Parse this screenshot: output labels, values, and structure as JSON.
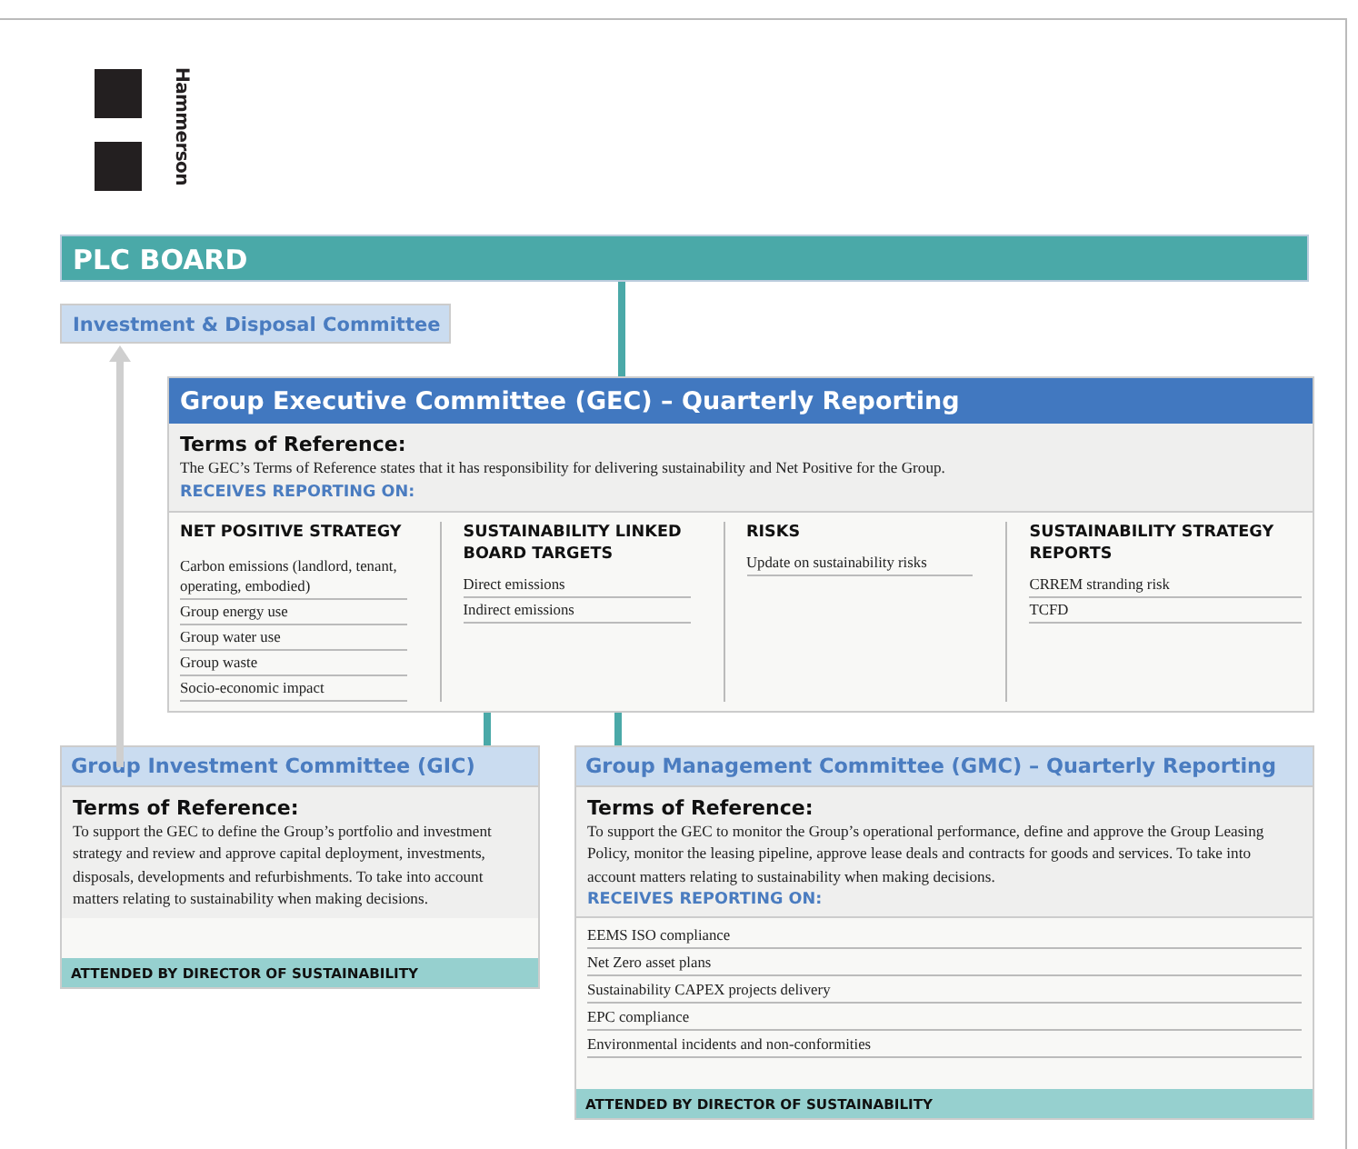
{
  "logo": {
    "name": "Hammerson"
  },
  "board": {
    "title": "PLC BOARD"
  },
  "side_committee": {
    "title": "Investment & Disposal Committee"
  },
  "gec": {
    "title": "Group Executive Committee (GEC) – Quarterly Reporting",
    "terms_heading": "Terms of Reference:",
    "terms": "The GEC’s Terms of Reference states that it has responsibility for delivering sustainability and Net Positive for the Group.",
    "reporting_heading": "RECEIVES REPORTING ON:",
    "columns": [
      {
        "heading": "NET POSITIVE STRATEGY",
        "items": [
          "Carbon emissions (landlord, tenant, operating, embodied)",
          "Group energy use",
          "Group water use",
          "Group waste",
          "Socio-economic impact"
        ]
      },
      {
        "heading": "SUSTAINABILITY LINKED BOARD TARGETS",
        "items": [
          "Direct emissions",
          "Indirect emissions"
        ]
      },
      {
        "heading": "RISKS",
        "items": [
          "Update on sustainability risks"
        ]
      },
      {
        "heading": "SUSTAINABILITY STRATEGY REPORTS",
        "items": [
          "CRREM stranding risk",
          "TCFD"
        ]
      }
    ]
  },
  "committees": [
    {
      "title": "Group Investment Committee (GIC)",
      "terms_heading": "Terms of Reference:",
      "terms": "To support the GEC to define the Group’s portfolio and investment strategy and review and approve capital deployment, investments, disposals, developments and refurbishments. To take into account matters relating to sustainability when making decisions.",
      "footer": "ATTENDED BY DIRECTOR OF SUSTAINABILITY"
    },
    {
      "title": "Group Management Committee (GMC) – Quarterly Reporting",
      "terms_heading": "Terms of Reference:",
      "terms": "To support the GEC to monitor the Group’s operational performance, define and approve the Group Leasing Policy, monitor the leasing pipeline, approve lease deals and contracts for goods and services. To take into account matters relating to sustainability when making decisions.",
      "reporting_heading": "RECEIVES REPORTING ON:",
      "items": [
        "EEMS ISO compliance",
        "Net Zero asset plans",
        "Sustainability CAPEX projects delivery",
        "EPC compliance",
        "Environmental incidents and non-conformities"
      ],
      "footer": "ATTENDED BY DIRECTOR OF SUSTAINABILITY"
    }
  ]
}
